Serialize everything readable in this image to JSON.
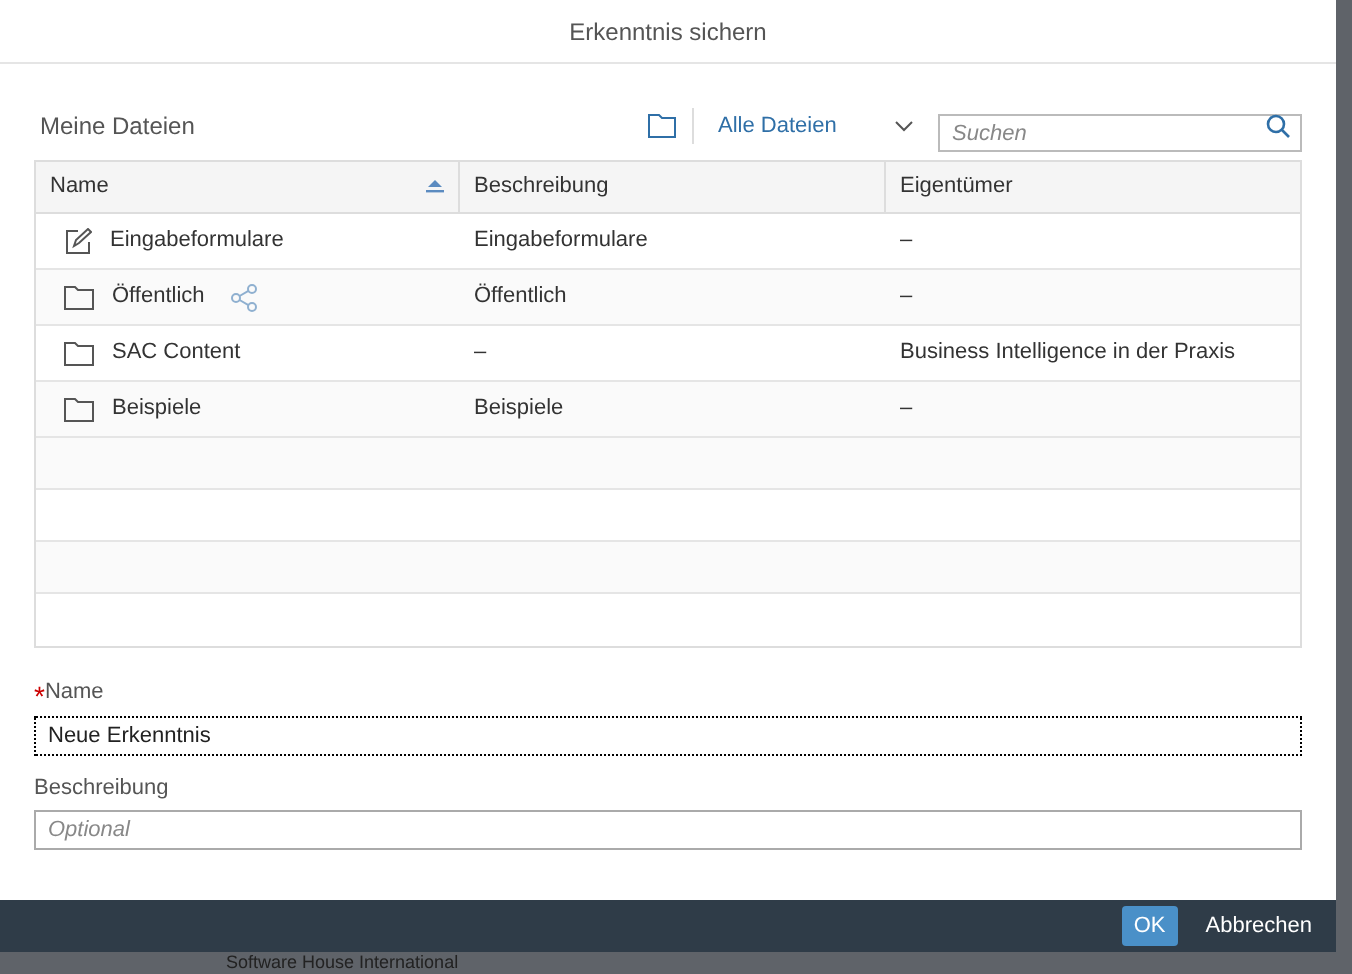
{
  "dialog": {
    "title": "Erkenntnis sichern"
  },
  "toolbar": {
    "heading": "Meine Dateien",
    "filter": "Alle Dateien",
    "search": {
      "placeholder": "Suchen"
    }
  },
  "table": {
    "columns": [
      {
        "label": "Name",
        "sorted": true
      },
      {
        "label": "Beschreibung",
        "sorted": false
      },
      {
        "label": "Eigentümer",
        "sorted": false
      }
    ],
    "rows": [
      {
        "kind": "edit",
        "name": "Eingabeformulare",
        "shared": false,
        "description": "Eingabeformulare",
        "owner": "–"
      },
      {
        "kind": "folder",
        "name": "Öffentlich",
        "shared": true,
        "description": "Öffentlich",
        "owner": "–"
      },
      {
        "kind": "folder",
        "name": "SAC Content",
        "shared": false,
        "description": "–",
        "owner": "Business Intelligence in der Praxis"
      },
      {
        "kind": "folder",
        "name": "Beispiele",
        "shared": false,
        "description": "Beispiele",
        "owner": "–"
      }
    ]
  },
  "form": {
    "name": {
      "label": "Name",
      "required": true,
      "required_marker": "*",
      "value": "Neue Erkenntnis"
    },
    "description": {
      "label": "Beschreibung",
      "required": false,
      "placeholder": "Optional"
    }
  },
  "footer": {
    "buttons": [
      {
        "label": "OK",
        "primary": true
      },
      {
        "label": "Abbrechen",
        "primary": false
      }
    ]
  },
  "background_text": "Software House International"
}
